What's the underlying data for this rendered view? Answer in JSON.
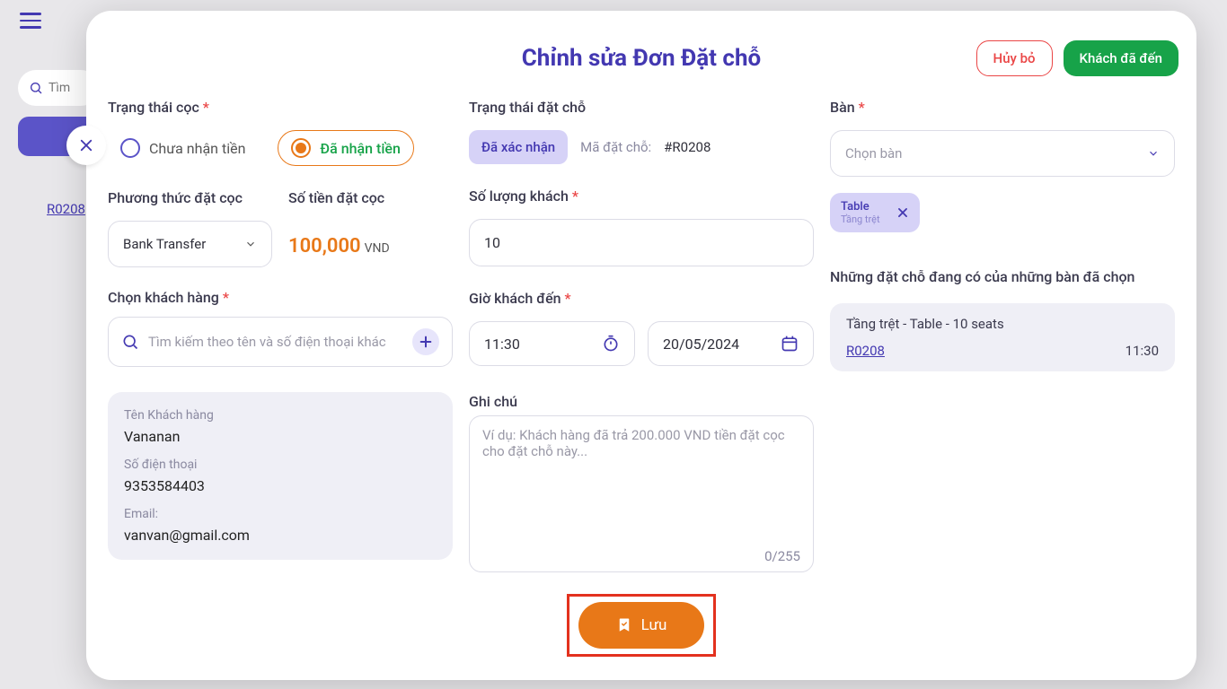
{
  "background": {
    "search_placeholder": "Tìm",
    "list_link": "R0208"
  },
  "modal": {
    "title": "Chỉnh sửa Đơn Đặt chỗ",
    "cancel": "Hủy bỏ",
    "arrived": "Khách đã đến",
    "deposit_status_label": "Trạng thái cọc",
    "radio_unpaid": "Chưa nhận tiền",
    "radio_paid": "Đã nhận tiền",
    "method_label": "Phương thức đặt cọc",
    "method_value": "Bank Transfer",
    "amount_label": "Số tiền đặt cọc",
    "amount_value": "100,000",
    "amount_currency": "VND",
    "customer_label": "Chọn khách hàng",
    "customer_search_placeholder": "Tìm kiếm theo tên và số điện thoại khác",
    "customer_card": {
      "name_label": "Tên Khách hàng",
      "name_value": "Vananan",
      "phone_label": "Số điện thoại",
      "phone_value": "9353584403",
      "email_label": "Email:",
      "email_value": "vanvan@gmail.com"
    },
    "res_status_label": "Trạng thái đặt chỗ",
    "status_badge": "Đã xác nhận",
    "res_code_label": "Mã đặt chỗ:",
    "res_code": "#R0208",
    "guest_count_label": "Số lượng khách",
    "guest_count_value": "10",
    "arrival_label": "Giờ khách đến",
    "arrival_time": "11:30",
    "arrival_date": "20/05/2024",
    "note_label": "Ghi chú",
    "note_placeholder": "Ví dụ: Khách hàng đã trả 200.000 VND tiền đặt cọc cho đặt chỗ này...",
    "note_counter": "0/255",
    "table_label": "Bàn",
    "table_placeholder": "Chọn bàn",
    "table_chip": {
      "name": "Table",
      "floor": "Tầng trệt"
    },
    "existing_label": "Những đặt chỗ đang có của những bàn đã chọn",
    "existing_card": {
      "header": "Tầng trệt - Table  - 10 seats",
      "link": "R0208",
      "time": "11:30"
    },
    "save": "Lưu"
  }
}
